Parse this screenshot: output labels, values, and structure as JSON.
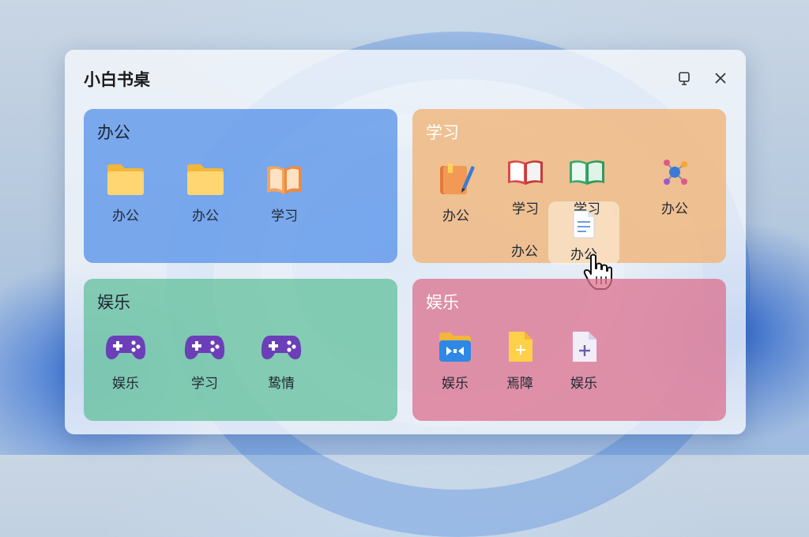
{
  "window": {
    "title": "小白书桌",
    "pin_icon": "pin-icon",
    "close_icon": "close-icon"
  },
  "panels": [
    {
      "title": "办公",
      "items": [
        {
          "label": "办公",
          "icon": "folder-icon"
        },
        {
          "label": "办公",
          "icon": "folder-icon"
        },
        {
          "label": "学习",
          "icon": "open-book-icon"
        }
      ]
    },
    {
      "title": "学习",
      "items": [
        {
          "label": "办公",
          "icon": "notebook-pen-icon"
        },
        {
          "label": "学习",
          "icon": "open-book-icon"
        },
        {
          "label": "学习",
          "icon": "green-book-icon"
        },
        {
          "label": "办公",
          "icon": "molecule-icon"
        },
        {
          "label": "办公",
          "icon": ""
        },
        {
          "label": "办公",
          "icon": "document-icon"
        }
      ]
    },
    {
      "title": "娱乐",
      "items": [
        {
          "label": "娱乐",
          "icon": "gamepad-icon"
        },
        {
          "label": "学习",
          "icon": "gamepad-icon"
        },
        {
          "label": "鸷情",
          "icon": "gamepad-icon"
        }
      ]
    },
    {
      "title": "娱乐",
      "items": [
        {
          "label": "娱乐",
          "icon": "media-folder-icon"
        },
        {
          "label": "焉障",
          "icon": "yellow-file-icon"
        },
        {
          "label": "娱乐",
          "icon": "add-file-icon"
        }
      ]
    }
  ],
  "colors": {
    "panel_blue": "#4e8ce8",
    "panel_orange": "#f0b478",
    "panel_green": "#5abe96",
    "panel_pink": "#dc6e8c"
  }
}
